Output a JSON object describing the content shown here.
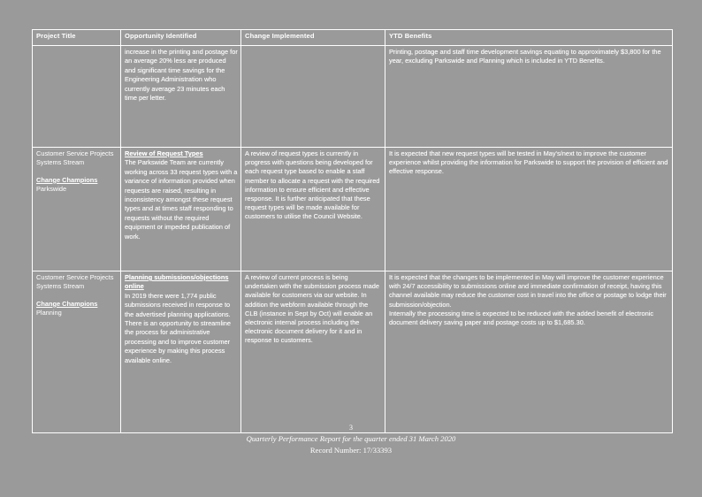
{
  "document": {
    "background_color": "#9a9a9a",
    "header_color": "#7ea6cc",
    "border_color": "#ffffff"
  },
  "table": {
    "columns": [
      {
        "key": "project_title",
        "label": "Project Title"
      },
      {
        "key": "opportunity",
        "label": "Opportunity Identified"
      },
      {
        "key": "change_implemented",
        "label": "Change Implemented"
      },
      {
        "key": "ytd_benefits",
        "label": "YTD Benefits"
      }
    ],
    "rows": [
      {
        "project_title": "",
        "project_stream": "",
        "champions_label": "",
        "champions_value": "",
        "opportunity_heading": "",
        "opportunity_body": "increase in the printing and postage for an average 20% less are produced and significant time savings for the Engineering Administration who currently average 23 minutes each time per letter.",
        "change_body": "",
        "ytd_body": "Printing, postage and staff time development savings equating to approximately $3,800 for the year, excluding Parkswide and Planning which is included in YTD Benefits."
      },
      {
        "project_title": "Customer Service Projects",
        "project_stream": "Systems Stream",
        "champions_label": "Change Champions",
        "champions_value": "Parkswide",
        "opportunity_heading": "Review of Request Types",
        "opportunity_body": "The Parkswide Team are currently working across 33 request types with a variance of information provided when requests are raised, resulting in inconsistency amongst these request types and at times staff responding to requests without the required equipment or impeded publication of work.",
        "change_body": "A review of request types is currently in progress with questions being developed for each request type based to enable a staff member to allocate a request with the required information to ensure efficient and effective response. It is further anticipated that these request types will be made available for customers to utilise the Council Website.",
        "ytd_body": "It is expected that new request types will be tested in May's/next to improve the customer experience whilst providing the information for Parkswide to support the provision of efficient and effective response."
      },
      {
        "project_title": "Customer Service Projects",
        "project_stream": "Systems Stream",
        "champions_label": "Change Champions",
        "champions_value": "Planning",
        "opportunity_heading": "Planning submissions/objections online",
        "opportunity_body": "In 2019 there were 1,774 public submissions received in response to the advertised planning applications. There is an opportunity to streamline the process for administrative processing and to improve customer experience by making this process available online.",
        "change_body": "A review of current process is being undertaken with the submission process made available for customers via our website. In addition the webform available through the CLB (instance in Sept by Oct) will enable an electronic internal process including the electronic document delivery for it and in response to customers.",
        "ytd_body": "It is expected that the changes to be implemented in May will improve the customer experience with 24/7 accessibility to submissions online and immediate confirmation of receipt, having this channel available may reduce the customer cost in travel into the office or postage to lodge their submission/objection.",
        "ytd_body_2": "Internally the processing time is expected to be reduced with the added benefit of electronic document delivery saving paper and postage costs up to $1,685.30."
      }
    ]
  },
  "footer": {
    "page_number": "3",
    "report_title": "Quarterly Performance Report for the quarter ended 31 March 2020",
    "record_number": "Record Number: 17/33393"
  }
}
